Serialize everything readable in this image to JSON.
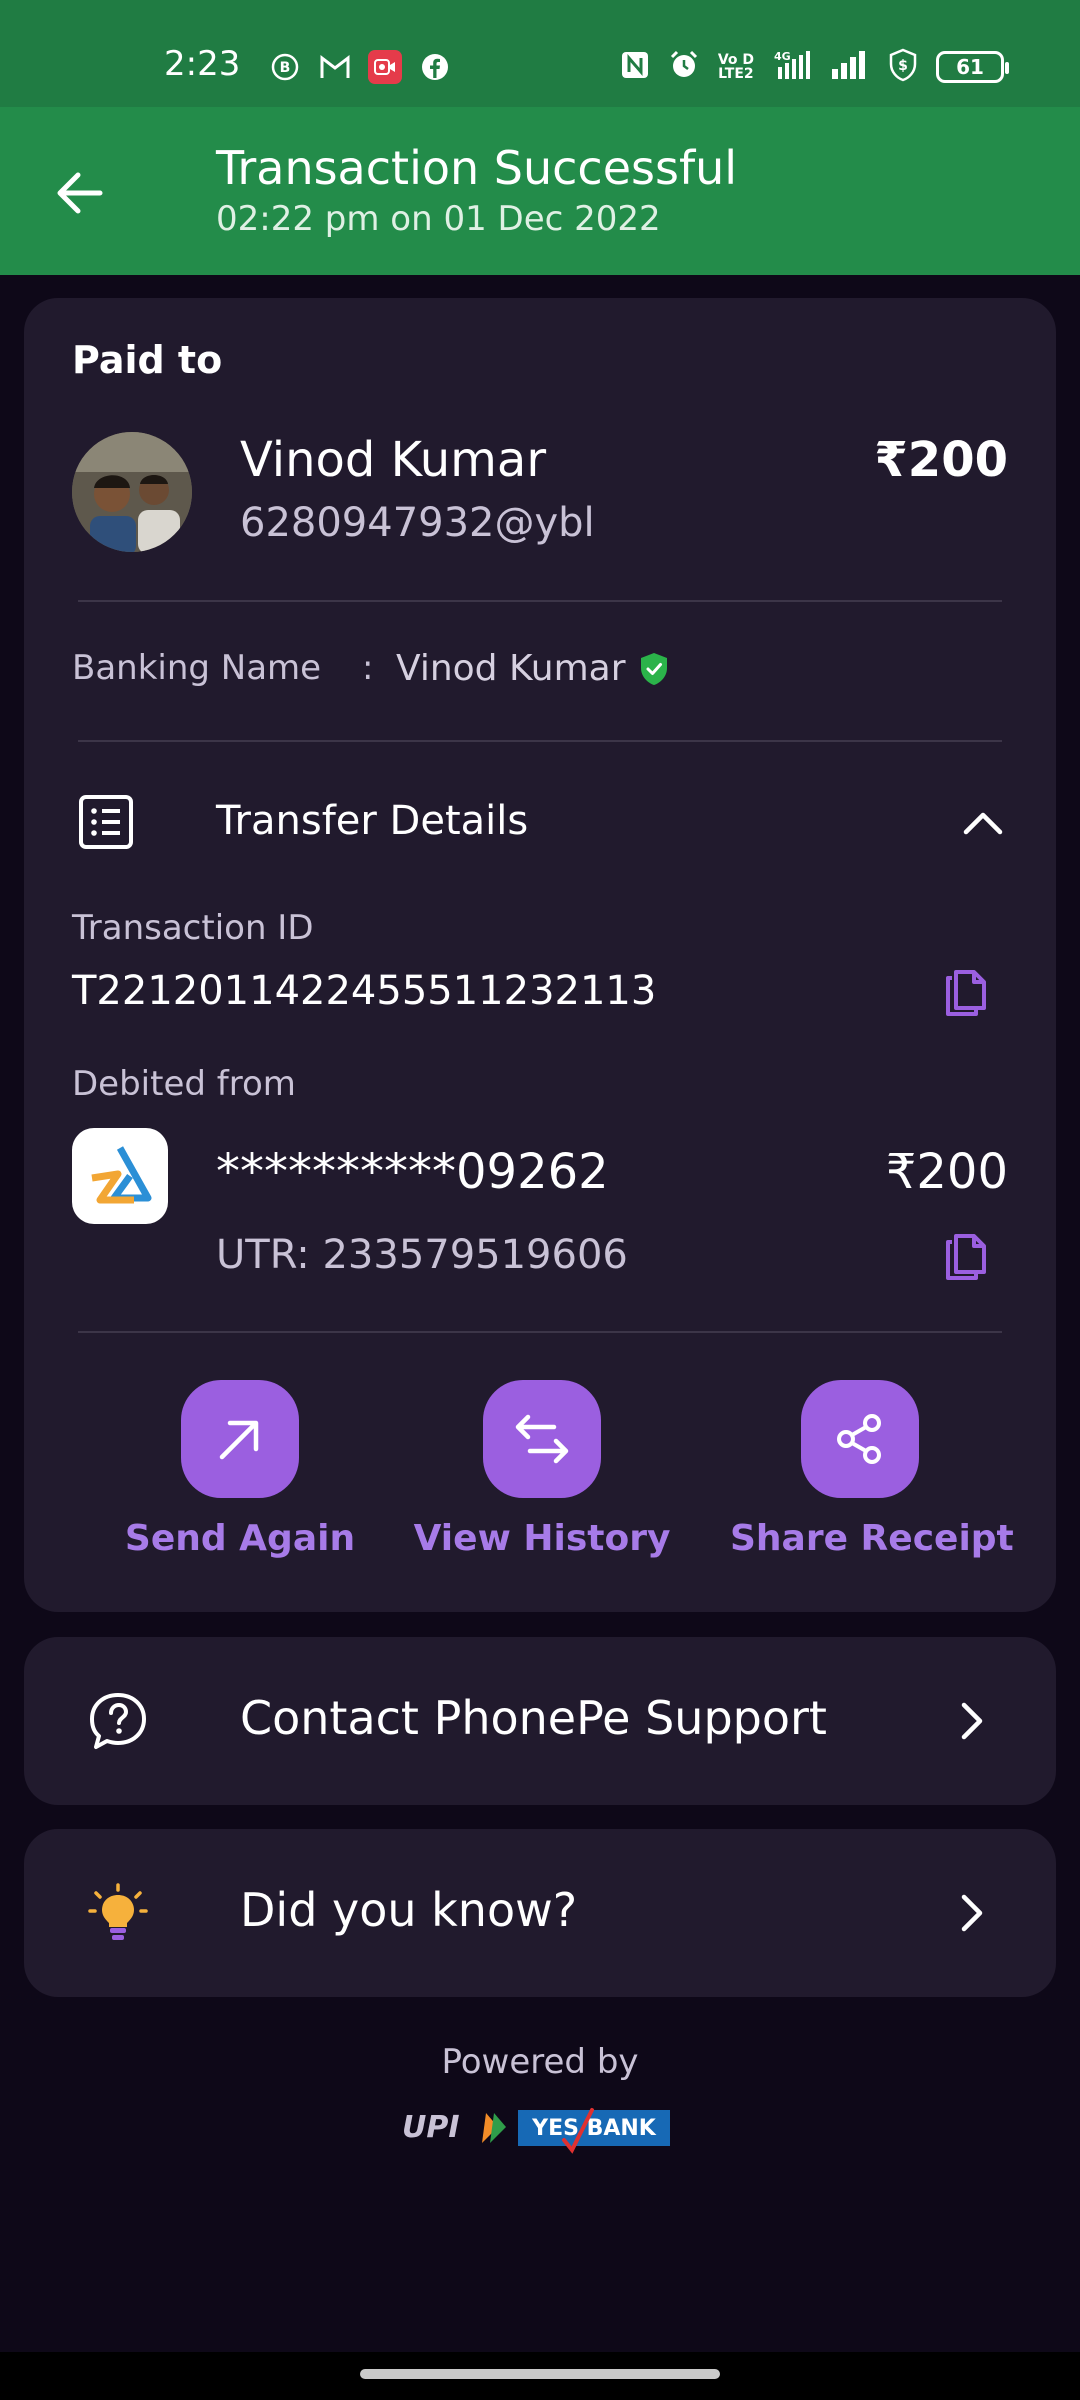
{
  "status_bar": {
    "time": "2:23",
    "battery": "61",
    "network": "4G",
    "volte": "Vo LTE2",
    "left_icons": [
      "b-icon",
      "gmail-icon",
      "screen-record-icon",
      "facebook-icon"
    ],
    "right_icons": [
      "nfc-icon",
      "alarm-icon",
      "volte-icon",
      "4g-signal-icon",
      "signal-icon",
      "shield-dollar-icon",
      "battery-icon"
    ]
  },
  "header": {
    "title": "Transaction Successful",
    "subtitle": "02:22 pm on 01 Dec 2022",
    "bg_color": "#238c4a"
  },
  "payee": {
    "section_label": "Paid to",
    "name": "Vinod Kumar",
    "upi_id": "6280947932@ybl",
    "amount": "₹200"
  },
  "banking": {
    "label": "Banking Name",
    "separator": ":",
    "name": "Vinod Kumar"
  },
  "transfer": {
    "title": "Transfer Details",
    "txn_label": "Transaction ID",
    "txn_id": "T2212011422455511232113",
    "debit_label": "Debited from",
    "account": "**********09262",
    "amount": "₹200",
    "utr": "UTR: 233579519606"
  },
  "actions": [
    {
      "label": "Send Again",
      "icon": "arrow-up-right-icon"
    },
    {
      "label": "View History",
      "icon": "swap-arrows-icon"
    },
    {
      "label": "Share Receipt",
      "icon": "share-icon"
    }
  ],
  "support": {
    "label": "Contact PhonePe Support"
  },
  "tips": {
    "label": "Did you know?"
  },
  "footer": {
    "powered_by": "Powered by",
    "upi_text": "UPI",
    "bank_text": "YES BANK"
  },
  "colors": {
    "accent": "#9b5fe0",
    "card": "#211a2d",
    "background": "#0e0818"
  }
}
